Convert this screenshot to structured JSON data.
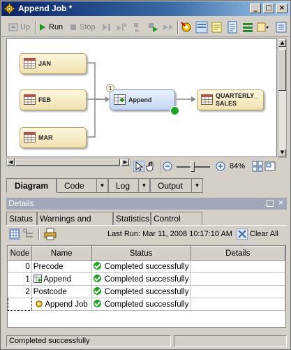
{
  "window": {
    "title": "Append Job *"
  },
  "toolbar": {
    "up_label": "Up",
    "run_label": "Run",
    "stop_label": "Stop"
  },
  "diagram": {
    "nodes": {
      "jan": "JAN",
      "feb": "FEB",
      "mar": "MAR",
      "append": "Append",
      "append_badge": "1",
      "output_line1": "QUARTERLY_",
      "output_line2": "SALES"
    },
    "zoom": "84%"
  },
  "view_tabs": {
    "diagram": "Diagram",
    "code": "Code",
    "log": "Log",
    "output": "Output"
  },
  "details": {
    "title": "Details",
    "tabs": {
      "status": "Status",
      "warnings": "Warnings and Errors",
      "statistics": "Statistics",
      "control_flow": "Control Flow"
    },
    "last_run": "Last Run: Mar 11, 2008 10:17:10 AM",
    "clear_all": "Clear All",
    "columns": {
      "node": "Node",
      "name": "Name",
      "status": "Status",
      "details": "Details"
    },
    "rows": [
      {
        "node": "0",
        "name": "Precode",
        "status": "Completed successfully",
        "details": ""
      },
      {
        "node": "1",
        "name": "Append",
        "status": "Completed successfully",
        "details": ""
      },
      {
        "node": "2",
        "name": "Postcode",
        "status": "Completed successfully",
        "details": ""
      },
      {
        "node": "",
        "name": "Append Job",
        "status": "Completed successfully",
        "details": ""
      }
    ]
  },
  "statusbar": {
    "message": "Completed successfully"
  }
}
